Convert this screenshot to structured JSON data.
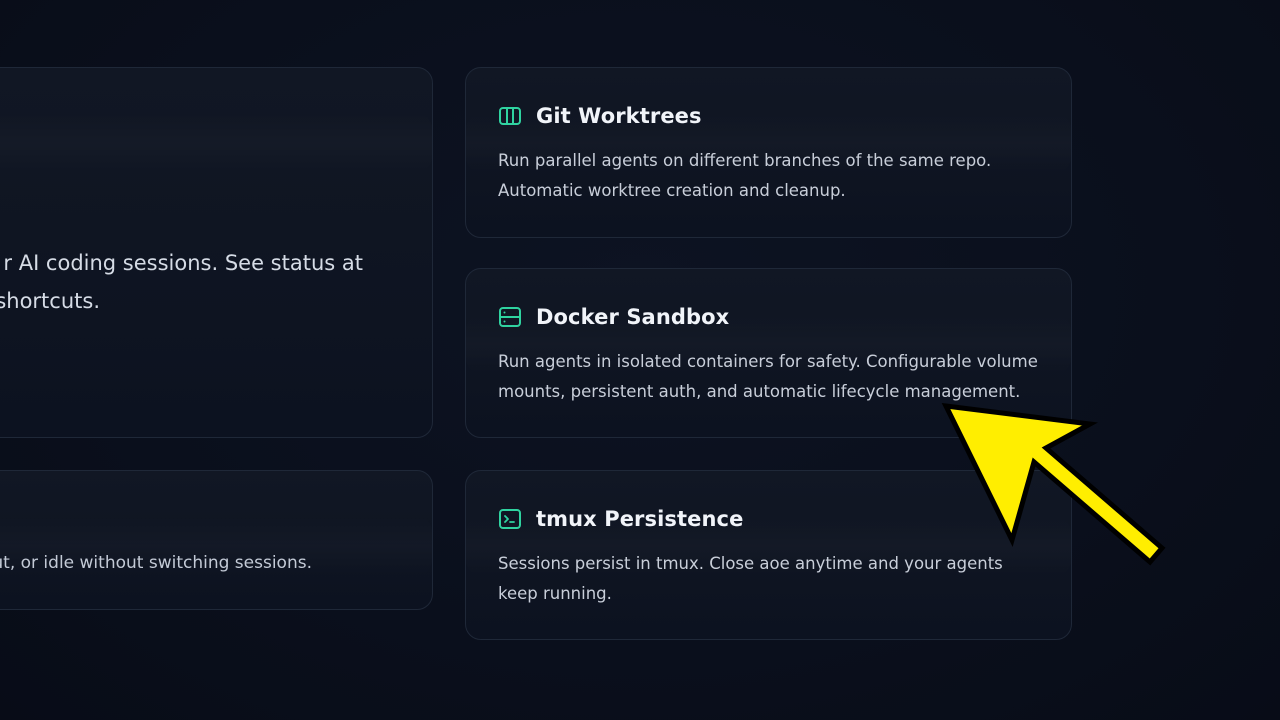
{
  "left_cards": {
    "top_desc_line1": "r AI coding sessions. See status at",
    "top_desc_line2": "shortcuts.",
    "bottom_desc": "ut, or idle without switching sessions."
  },
  "features": [
    {
      "icon": "columns-icon",
      "title": "Git Worktrees",
      "desc_line1": "Run parallel agents on different branches of the same repo.",
      "desc_line2": "Automatic worktree creation and cleanup."
    },
    {
      "icon": "server-icon",
      "title": "Docker Sandbox",
      "desc_line1": "Run agents in isolated containers for safety. Configurable volume",
      "desc_line2": "mounts, persistent auth, and automatic lifecycle management."
    },
    {
      "icon": "terminal-icon",
      "title": "tmux Persistence",
      "desc_line1": "Sessions persist in tmux. Close aoe anytime and your agents",
      "desc_line2": "keep running."
    }
  ],
  "colors": {
    "background": "#0a0f1c",
    "card_border": "#1f2838",
    "accent_green": "#2fd3a0",
    "arrow_fill": "#ffee00",
    "arrow_outline": "#000000"
  }
}
